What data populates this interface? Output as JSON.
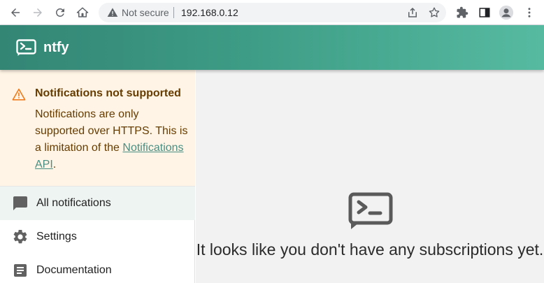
{
  "browser": {
    "security_status": "Not secure",
    "url": "192.168.0.12",
    "icons": [
      "back-icon",
      "forward-icon",
      "reload-icon",
      "home-icon",
      "warning-icon",
      "share-icon",
      "star-icon",
      "extensions-icon",
      "side-panel-icon",
      "profile-icon",
      "menu-icon"
    ]
  },
  "app": {
    "title": "ntfy",
    "accent_color": "#338574"
  },
  "sidebar": {
    "alert": {
      "title": "Notifications not supported",
      "body": "Notifications are only supported over HTTPS. This is a limitation of the ",
      "link_text": "Notifications API",
      "suffix": "."
    },
    "items": [
      {
        "label": "All notifications",
        "icon": "chat-icon",
        "selected": true
      },
      {
        "label": "Settings",
        "icon": "gear-icon",
        "selected": false
      },
      {
        "label": "Documentation",
        "icon": "article-icon",
        "selected": false
      }
    ]
  },
  "main": {
    "empty_message": "It looks like you don't have any subscriptions yet."
  }
}
